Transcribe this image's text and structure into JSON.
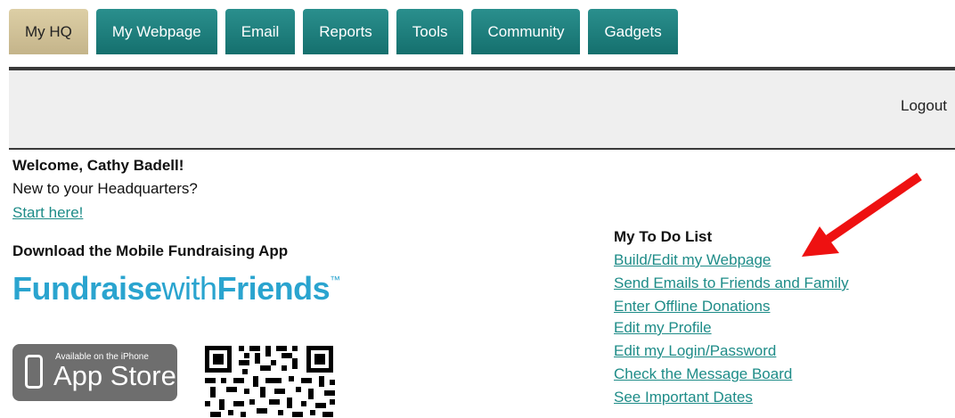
{
  "tabs": [
    {
      "label": "My HQ",
      "active": true
    },
    {
      "label": "My Webpage",
      "active": false
    },
    {
      "label": "Email",
      "active": false
    },
    {
      "label": "Reports",
      "active": false
    },
    {
      "label": "Tools",
      "active": false
    },
    {
      "label": "Community",
      "active": false
    },
    {
      "label": "Gadgets",
      "active": false
    }
  ],
  "topbar": {
    "logout": "Logout"
  },
  "welcome": {
    "greeting": "Welcome, Cathy Badell!",
    "new_to": "New to your Headquarters?",
    "start_link": "Start here!"
  },
  "app": {
    "heading": "Download the Mobile Fundraising App",
    "brand_part1": "Fundraise",
    "brand_part2": "with",
    "brand_part3": "Friends",
    "brand_tm": "™",
    "store_small": "Available on the iPhone",
    "store_big": "App Store"
  },
  "todo": {
    "title": "My To Do List",
    "items": [
      "Build/Edit my Webpage",
      "Send Emails to Friends and Family",
      "Enter Offline Donations",
      "Edit my Profile",
      "Edit my Login/Password",
      "Check the Message Board",
      "See Important Dates"
    ]
  },
  "colors": {
    "tab_teal": "#1e807e",
    "tab_active": "#d6c9a0",
    "link": "#1e8c88",
    "brand": "#2aa4cf",
    "arrow": "#ee1111"
  },
  "icons": [
    "iphone-icon",
    "qr-code",
    "red-arrow"
  ]
}
